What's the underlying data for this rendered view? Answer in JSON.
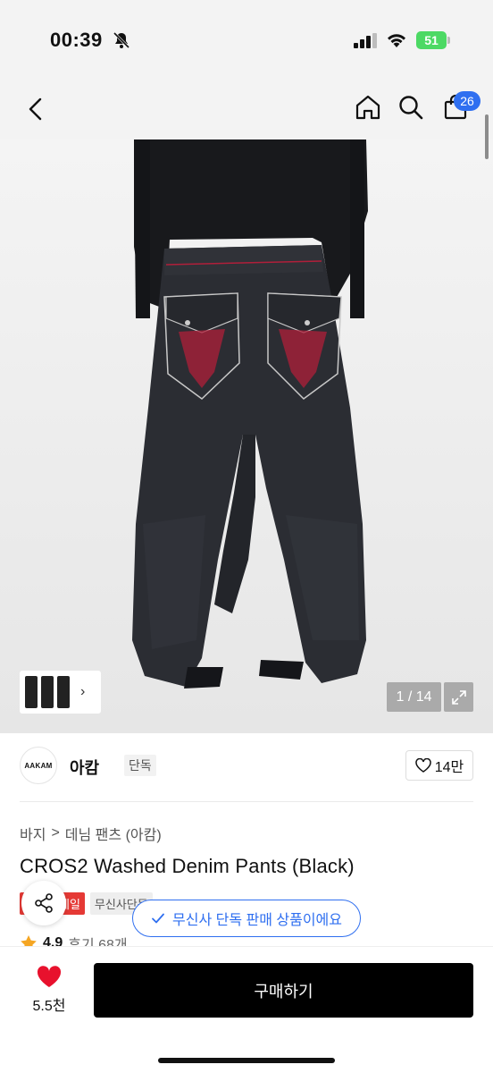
{
  "status_bar": {
    "time": "00:39",
    "battery": "51",
    "icons": [
      "bell-slash-icon",
      "signal-icon",
      "wifi-icon",
      "battery-icon"
    ]
  },
  "nav": {
    "cart_count": "26",
    "icons": [
      "chevron-left-icon",
      "home-icon",
      "search-icon",
      "bag-icon"
    ]
  },
  "gallery": {
    "counter": "1 / 14",
    "pocket_stitch_color": "#b01f3a",
    "denim_color": "#2b2d33"
  },
  "brand": {
    "logo_text": "AAKAM",
    "name": "아캄",
    "tag": "단독",
    "likes": "14만"
  },
  "breadcrumb": {
    "category": "바지",
    "separator": ">",
    "subcategory": "데님 팬츠 (아캄)"
  },
  "product": {
    "title": "CROS2 Washed Denim Pants (Black)",
    "badge_sale": "세일",
    "badge_exclusive": "무신사단독",
    "rating": "4.9",
    "reviews": "후기 68개"
  },
  "toast": {
    "message": "무신사 단독 판매 상품이에요"
  },
  "bottom_bar": {
    "wish_count": "5.5천",
    "buy_label": "구매하기"
  },
  "colors": {
    "accent": "#2f6ff0",
    "sale": "#e53935",
    "heart": "#e8112d",
    "buy_button": "#000000"
  }
}
